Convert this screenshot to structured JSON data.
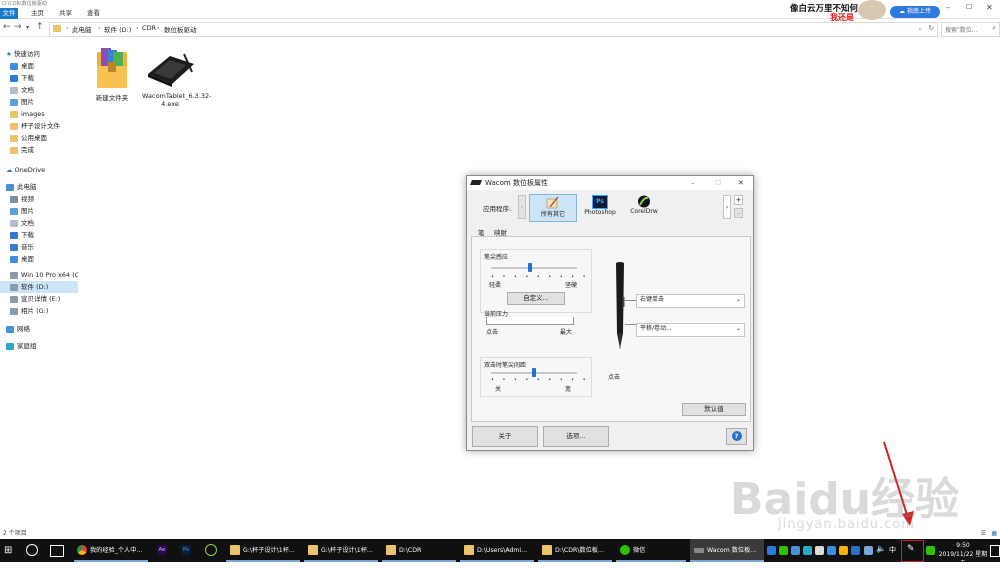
{
  "explorer": {
    "window_title": "D:\\CDR\\数位板驱动",
    "ribbon_tabs": [
      "文件",
      "主页",
      "共享",
      "查看"
    ],
    "breadcrumb": [
      "此电脑",
      "软件 (D:)",
      "CDR",
      "数位板驱动"
    ],
    "search_placeholder": "搜索\"数位...",
    "nav": {
      "quick_access": "快速访问",
      "quick_items": [
        "桌面",
        "下载",
        "文档",
        "图片",
        "images",
        "杯子设计文件",
        "公用桌面",
        "完成"
      ],
      "onedrive": "OneDrive",
      "this_pc": "此电脑",
      "pc_items": [
        "视频",
        "图片",
        "文档",
        "下载",
        "音乐",
        "桌面",
        "Win 10 Pro x64 (C",
        "软件 (D:)",
        "宣贝详情 (E:)",
        "相片 (G:)"
      ],
      "network": "网络",
      "homegroup": "家庭组"
    },
    "files": [
      {
        "name": "新建文件夹",
        "icon": "winrar-archive-icon"
      },
      {
        "name": "WacomTablet_6.3.32-4.exe",
        "icon": "tablet-exe-icon"
      }
    ],
    "status": "2 个项目"
  },
  "banner": {
    "line1": "像白云万里不知何",
    "line2": "我还是",
    "upload_label": "指南上传"
  },
  "dialog": {
    "title": "Wacom 数位板属性",
    "app_label": "应用程序:",
    "apps": [
      "所有其它",
      "Photoshop",
      "CorelDrw"
    ],
    "tabs": [
      "笔",
      "映射"
    ],
    "tip_feel": {
      "title": "笔尖感应",
      "min_label": "轻柔",
      "max_label": "坚硬",
      "customize": "自定义...",
      "level": 0.45
    },
    "pressure": {
      "title": "当前压力",
      "min_label": "点击",
      "max_label": "最大"
    },
    "double_click": {
      "title": "双击时笔尖间距",
      "min_label": "关",
      "max_label": "宽",
      "level": 0.5
    },
    "pen_buttons": [
      "右键单击",
      "平移/卷动..."
    ],
    "pen_tip_label": "点击",
    "default_btn": "默认值",
    "about_btn": "关于",
    "options_btn": "选项...",
    "help_btn": "?"
  },
  "taskbar": {
    "items": [
      "我的经验_个人中...",
      "G:\\杯子设计\\1杯...",
      "G:\\杯子设计\\1杯...",
      "D:\\CDR",
      "D:\\Users\\Admi...",
      "D:\\CDR\\数位板...",
      "微信",
      "Wacom 数位板..."
    ],
    "time": "9:50",
    "date": "2019/11/22 星期五"
  },
  "watermark": {
    "brand": "Baidu经验",
    "url": "jingyan.baidu.com"
  },
  "colors": {
    "accent": "#1979ca",
    "taskbar": "#101010",
    "highlight_box": "#d32020"
  }
}
